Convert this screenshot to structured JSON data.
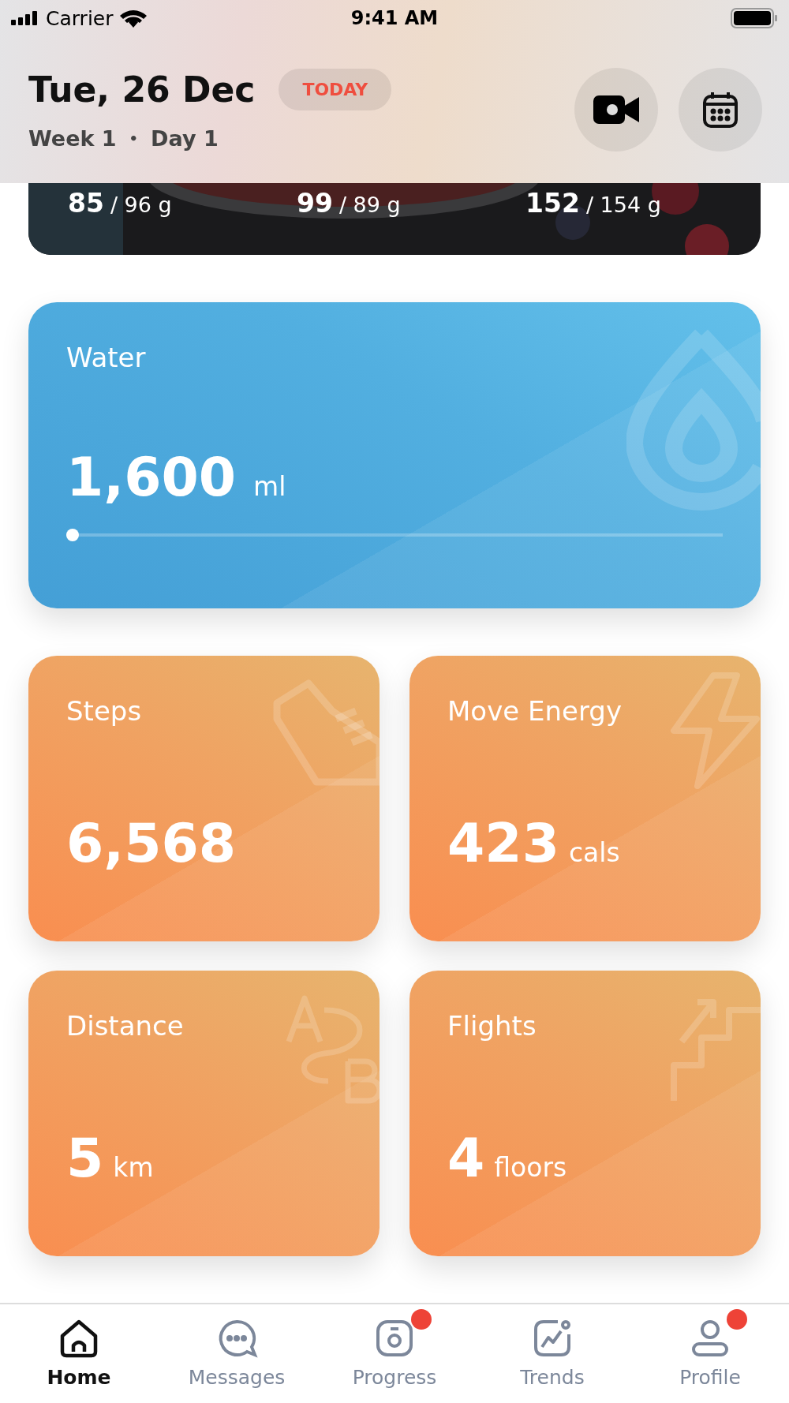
{
  "status_bar": {
    "carrier": "Carrier",
    "time": "9:41 AM"
  },
  "header": {
    "date": "Tue, 26 Dec",
    "badge": "TODAY",
    "week": "Week 1",
    "separator": "•",
    "day": "Day 1"
  },
  "macros": [
    {
      "value": "85",
      "target": "/ 96 g"
    },
    {
      "value": "99",
      "target": "/ 89 g"
    },
    {
      "value": "152",
      "target": "/ 154 g"
    }
  ],
  "water": {
    "title": "Water",
    "value": "1,600",
    "unit": "ml",
    "level": 0
  },
  "tiles": [
    {
      "kind": "steps",
      "title": "Steps",
      "value": "6,568"
    },
    {
      "kind": "energy",
      "title": "Move Energy",
      "value": "423",
      "unit": "cals"
    },
    {
      "kind": "distance",
      "title": "Distance",
      "value": "5",
      "unit": "km"
    },
    {
      "kind": "flights",
      "title": "Flights",
      "value": "4",
      "unit": "floors"
    }
  ],
  "tab_bar": [
    {
      "label": "Home",
      "selected": true,
      "badge": false
    },
    {
      "label": "Messages",
      "selected": false,
      "badge": false
    },
    {
      "label": "Progress",
      "selected": false,
      "badge": true
    },
    {
      "label": "Trends",
      "selected": false,
      "badge": false
    },
    {
      "label": "Profile",
      "selected": false,
      "badge": true
    }
  ]
}
